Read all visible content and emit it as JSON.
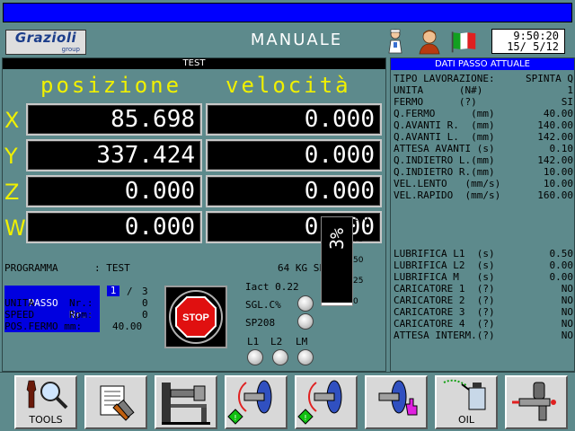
{
  "header": {
    "logo": {
      "name": "Grazioli",
      "sub": "group"
    },
    "title": "MANUALE",
    "clock": {
      "time": "9:50:20",
      "date": "15/ 5/12"
    },
    "icons": [
      "operator-icon",
      "user-icon",
      "italian-flag-icon"
    ]
  },
  "left": {
    "bar_title": "TEST",
    "col_position": "posizione",
    "col_speed": "velocità",
    "axes": [
      {
        "axis": "X",
        "position": "85.698",
        "speed": "0.000"
      },
      {
        "axis": "Y",
        "position": "337.424",
        "speed": "0.000"
      },
      {
        "axis": "Z",
        "position": "0.000",
        "speed": "0.000"
      },
      {
        "axis": "W",
        "position": "0.000",
        "speed": "0.000"
      }
    ],
    "programma_label": "PROGRAMMA",
    "programma_value": ": TEST",
    "spinta_label": "64 KG SPINTA",
    "passo": {
      "label": "PASSO",
      "nr_label": "Nr.:",
      "current": "1",
      "sep": "/",
      "total": "3"
    },
    "unita": {
      "label": "UNITA",
      "nr_label": "Nr.:",
      "value": "0"
    },
    "speed": {
      "label": "SPEED",
      "unit": "Rpm:",
      "value": "0"
    },
    "pos_fermo": {
      "label": "POS.FERMO mm:",
      "value": "40.00"
    },
    "stop_label": "STOP",
    "iact": "Iact 0.22",
    "sgl": "SGL.C%",
    "sp": "SP208",
    "l1": "L1",
    "l2": "L2",
    "lm": "LM",
    "gauge": {
      "value": "3%",
      "ticks": [
        "100",
        "75",
        "50",
        "25",
        "0"
      ],
      "level_percent": 3
    }
  },
  "right": {
    "bar_title": "DATI PASSO ATTUALE",
    "rows": [
      {
        "label": "TIPO LAVORAZIONE:",
        "value": "SPINTA Q"
      },
      {
        "label": "UNITA      (N#)",
        "value": "1"
      },
      {
        "label": "FERMO      (?)",
        "value": "SI"
      },
      {
        "label": "Q.FERMO      (mm)",
        "value": "40.00"
      },
      {
        "label": "Q.AVANTI R.  (mm)",
        "value": "140.00"
      },
      {
        "label": "Q.AVANTI L.  (mm)",
        "value": "142.00"
      },
      {
        "label": "ATTESA AVANTI (s)",
        "value": "0.10"
      },
      {
        "label": "Q.INDIETRO L.(mm)",
        "value": "142.00"
      },
      {
        "label": "Q.INDIETRO R.(mm)",
        "value": "10.00"
      },
      {
        "label": "VEL.LENTO   (mm/s)",
        "value": "10.00"
      },
      {
        "label": "VEL.RAPIDO  (mm/s)",
        "value": "160.00"
      }
    ],
    "rows2": [
      {
        "label": "LUBRIFICA L1  (s)",
        "value": "0.50"
      },
      {
        "label": "LUBRIFICA L2  (s)",
        "value": "0.00"
      },
      {
        "label": "LUBRIFICA M   (s)",
        "value": "0.00"
      },
      {
        "label": "CARICATORE 1  (?)",
        "value": "NO"
      },
      {
        "label": "CARICATORE 2  (?)",
        "value": "NO"
      },
      {
        "label": "CARICATORE 3  (?)",
        "value": "NO"
      },
      {
        "label": "CARICATORE 4  (?)",
        "value": "NO"
      },
      {
        "label": "ATTESA INTERM.(?)",
        "value": "NO"
      }
    ]
  },
  "toolbar": {
    "tools": "TOOLS",
    "oil": "OIL"
  }
}
